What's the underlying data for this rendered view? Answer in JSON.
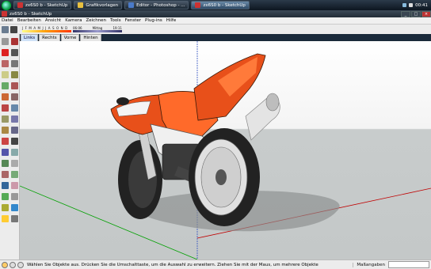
{
  "taskbar": {
    "tasks": [
      {
        "label": "zx6S0 b - SketchUp",
        "active": false,
        "color": "#c33"
      },
      {
        "label": "Grafikvorlagen",
        "active": false,
        "color": "#e8c040"
      },
      {
        "label": "Editor - Photoshop - ...",
        "active": false,
        "color": "#4a7ac8"
      },
      {
        "label": "zx6S0 b - SketchUp",
        "active": true,
        "color": "#c33"
      }
    ],
    "clock": "00:41"
  },
  "window": {
    "title": "zx6S0 b - SketchUp",
    "controls": [
      "_",
      "□",
      "×"
    ]
  },
  "menu": [
    "Datei",
    "Bearbeiten",
    "Ansicht",
    "Kamera",
    "Zeichnen",
    "Tools",
    "Fenster",
    "Plug-ins",
    "Hilfe"
  ],
  "shadow_settings": {
    "months": "J F M A M J J A S O N D",
    "time_start": "06:06",
    "time_mid": "Mittag",
    "time_end": "19:11"
  },
  "scene_tabs": [
    "Links",
    "Rechts",
    "Vorne",
    "Hinten"
  ],
  "active_scene": "Links",
  "status": {
    "hint": "Wählen Sie Objekte aus. Drücken Sie die Umschalttaste, um die Auswahl zu erweitern. Ziehen Sie mit der Maus, um mehrere Objekte",
    "measure_label": "Maßangaben",
    "measure_value": ""
  },
  "colors": {
    "accent_orange": "#e8501a",
    "axis_red": "#c00000",
    "axis_green": "#00a000",
    "axis_blue": "#3050c0"
  },
  "icons": {
    "palette": [
      "arrow-select-icon",
      "component-icon",
      "pencil-icon",
      "arc-icon",
      "circle-icon",
      "polygon-icon",
      "eraser-icon",
      "paint-bucket-icon",
      "push-pull-icon",
      "move-icon",
      "rotate-icon",
      "follow-me-icon",
      "scale-icon",
      "offset-icon",
      "tape-measure-icon",
      "dimension-icon",
      "protractor-icon",
      "text-icon",
      "axes-icon",
      "3d-text-icon",
      "orbit-icon",
      "pan-icon",
      "zoom-icon",
      "zoom-window-icon",
      "zoom-extents-icon",
      "previous-view-icon",
      "position-camera-icon",
      "walk-icon",
      "look-around-icon",
      "section-plane-icon",
      "sandbox-icon",
      "layers-icon",
      "solar-icon",
      "settings-icon"
    ]
  }
}
